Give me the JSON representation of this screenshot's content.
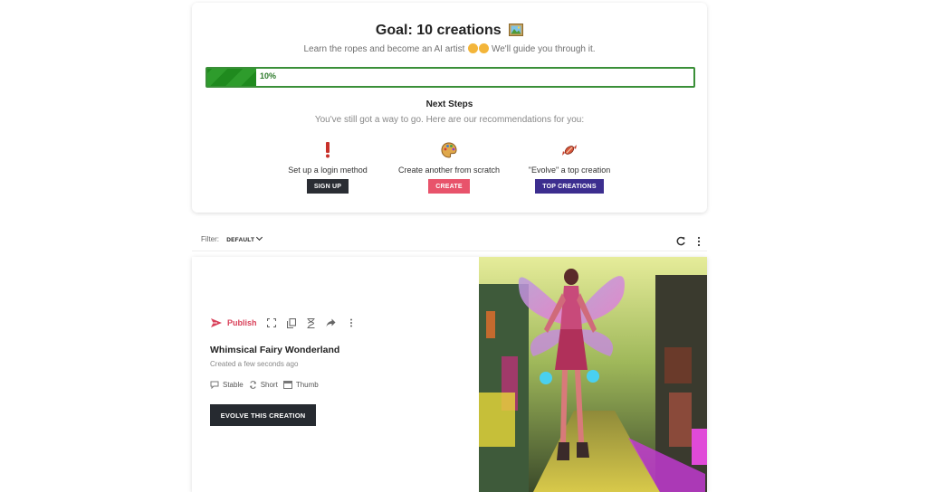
{
  "goal": {
    "title": "Goal: 10 creations",
    "subtitle_pre": "Learn the ropes and become an AI artist",
    "subtitle_post": "We'll guide you through it.",
    "progress_percent": 10,
    "progress_label": "10%",
    "progress_color": "#1f8a1e"
  },
  "next_steps": {
    "title": "Next Steps",
    "subtitle": "You've still got a way to go. Here are our recommendations for you:",
    "items": [
      {
        "icon": "exclamation-icon",
        "label": "Set up a login method",
        "button": "SIGN UP",
        "color": "#2a2d33"
      },
      {
        "icon": "palette-icon",
        "label": "Create another from scratch",
        "button": "CREATE",
        "color": "#e8536b"
      },
      {
        "icon": "candy-icon",
        "label": "\"Evolve\" a top creation",
        "button": "TOP CREATIONS",
        "color": "#3c2e8f"
      }
    ]
  },
  "filter": {
    "label": "Filter:",
    "value": "DEFAULT"
  },
  "creation": {
    "publish_label": "Publish",
    "title": "Whimsical Fairy Wonderland",
    "created": "Created a few seconds ago",
    "tags": [
      "Stable",
      "Short",
      "Thumb"
    ],
    "evolve_label": "EVOLVE THIS CREATION",
    "accent": "#d9415a"
  }
}
